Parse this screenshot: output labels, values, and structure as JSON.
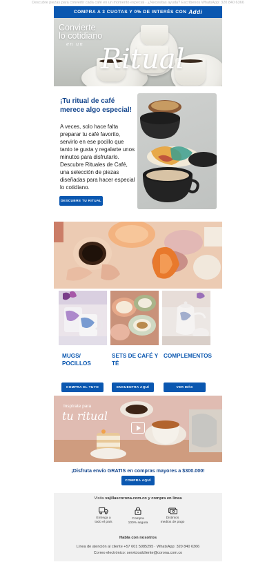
{
  "preheader": "Descubre piezas para convertir cada café en un momento especial · ¿Necesitas ayuda? Escríbenos WhatsApp: 320 840 6366",
  "promo_bar": {
    "text": "COMPRA A 3 CUOTAS Y 0% DE INTERÉS CON",
    "brand": "Addi"
  },
  "hero": {
    "title_line1": "Convierte",
    "title_line2": "lo cotidiano",
    "subtitle": "en un",
    "script": "Ritual"
  },
  "intro": {
    "title": "¡Tu ritual de café merece algo especial!",
    "paragraph1": "A veces, solo hace falta preparar tu café favorito, servirlo en ese pocillo que tanto te gusta y regalarte unos minutos para disfrutarlo.",
    "paragraph2": "Descubre Rituales de Café, una selección de piezas diseñadas para hacer especial lo cotidiano.",
    "button": "DESCUBRE TU RITUAL"
  },
  "categories": [
    {
      "title": "MUGS/ POCILLOS",
      "button": "COMPRA EL TUYO"
    },
    {
      "title": "SETS DE CAFÉ Y TÉ",
      "button": "ENCUENTRA AQUÍ"
    },
    {
      "title": "COMPLEMENTOS",
      "button": "VER MÁS"
    }
  ],
  "video_banner": {
    "title": "Inspírate para",
    "script": "tu ritual"
  },
  "shipping": {
    "text": "¡Disfruta envío GRATIS en compras mayores a $300.000!",
    "button": "COMPRA AQUÍ"
  },
  "footer": {
    "visit_prefix": "Visita",
    "visit_link": "vajillascorona.com.co",
    "visit_suffix": "y compra en línea",
    "features": [
      {
        "icon": "truck-icon",
        "line1": "Entrega a",
        "line2": "todo el país"
      },
      {
        "icon": "lock-icon",
        "line1": "Compra",
        "line2": "100% segura"
      },
      {
        "icon": "payment-icon",
        "line1": "Distintos",
        "line2": "medios de pago"
      }
    ],
    "help_title": "Habla con nosotros",
    "contact_line": "Línea de atención al cliente +57 601 5085295 · WhatsApp: 320 840 6366",
    "email_line": "Correo electrónico: servicioalcliente@corona.com.co"
  },
  "colors": {
    "brand_blue": "#0a57b0",
    "title_blue": "#14468d",
    "footer_bg": "#f1f1f1"
  }
}
